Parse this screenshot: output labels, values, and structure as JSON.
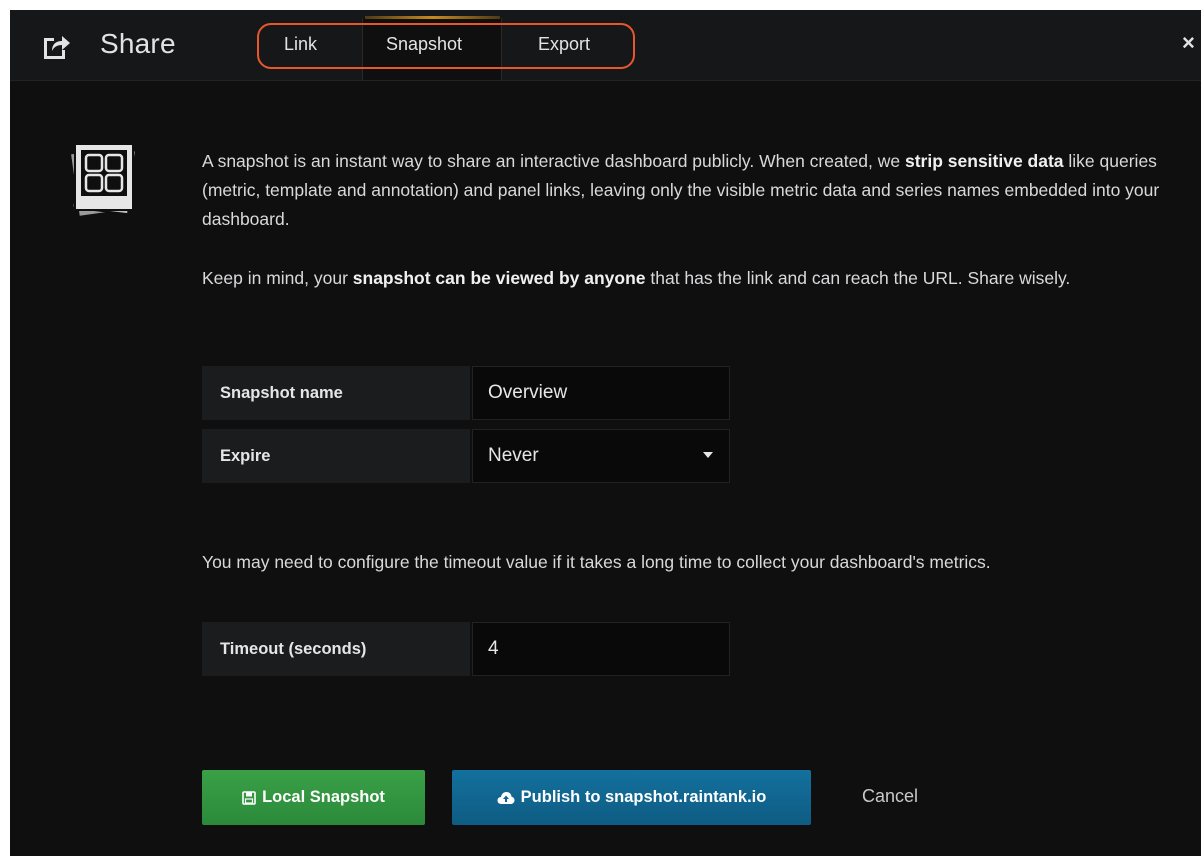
{
  "header": {
    "title": "Share",
    "icon": "share-icon",
    "close_icon": "close-icon",
    "close_glyph": "×"
  },
  "tabs": [
    {
      "label": "Link",
      "active": false
    },
    {
      "label": "Snapshot",
      "active": true
    },
    {
      "label": "Export",
      "active": false
    }
  ],
  "intro": {
    "p1_a": "A snapshot is an instant way to share an interactive dashboard publicly. When created, we ",
    "p1_b": "strip sensitive data",
    "p1_c": " like queries (metric, template and annotation) and panel links, leaving only the visible metric data and series names embedded into your dashboard.",
    "p2_a": "Keep in mind, your ",
    "p2_b": "snapshot can be viewed by anyone",
    "p2_c": " that has the link and can reach the URL. Share wisely."
  },
  "form": {
    "name_label": "Snapshot name",
    "name_value": "Overview",
    "expire_label": "Expire",
    "expire_value": "Never",
    "timeout_note": "You may need to configure the timeout value if it takes a long time to collect your dashboard's metrics.",
    "timeout_label": "Timeout (seconds)",
    "timeout_value": "4"
  },
  "buttons": {
    "local_label": "Local Snapshot",
    "local_icon": "save-icon",
    "publish_label": "Publish to snapshot.raintank.io",
    "publish_icon": "cloud-upload-icon",
    "cancel_label": "Cancel"
  },
  "colors": {
    "highlight": "#e8572c",
    "local_button": "#2f9140",
    "publish_button": "#11658f",
    "active_tab_accent": "#c98a1d"
  }
}
